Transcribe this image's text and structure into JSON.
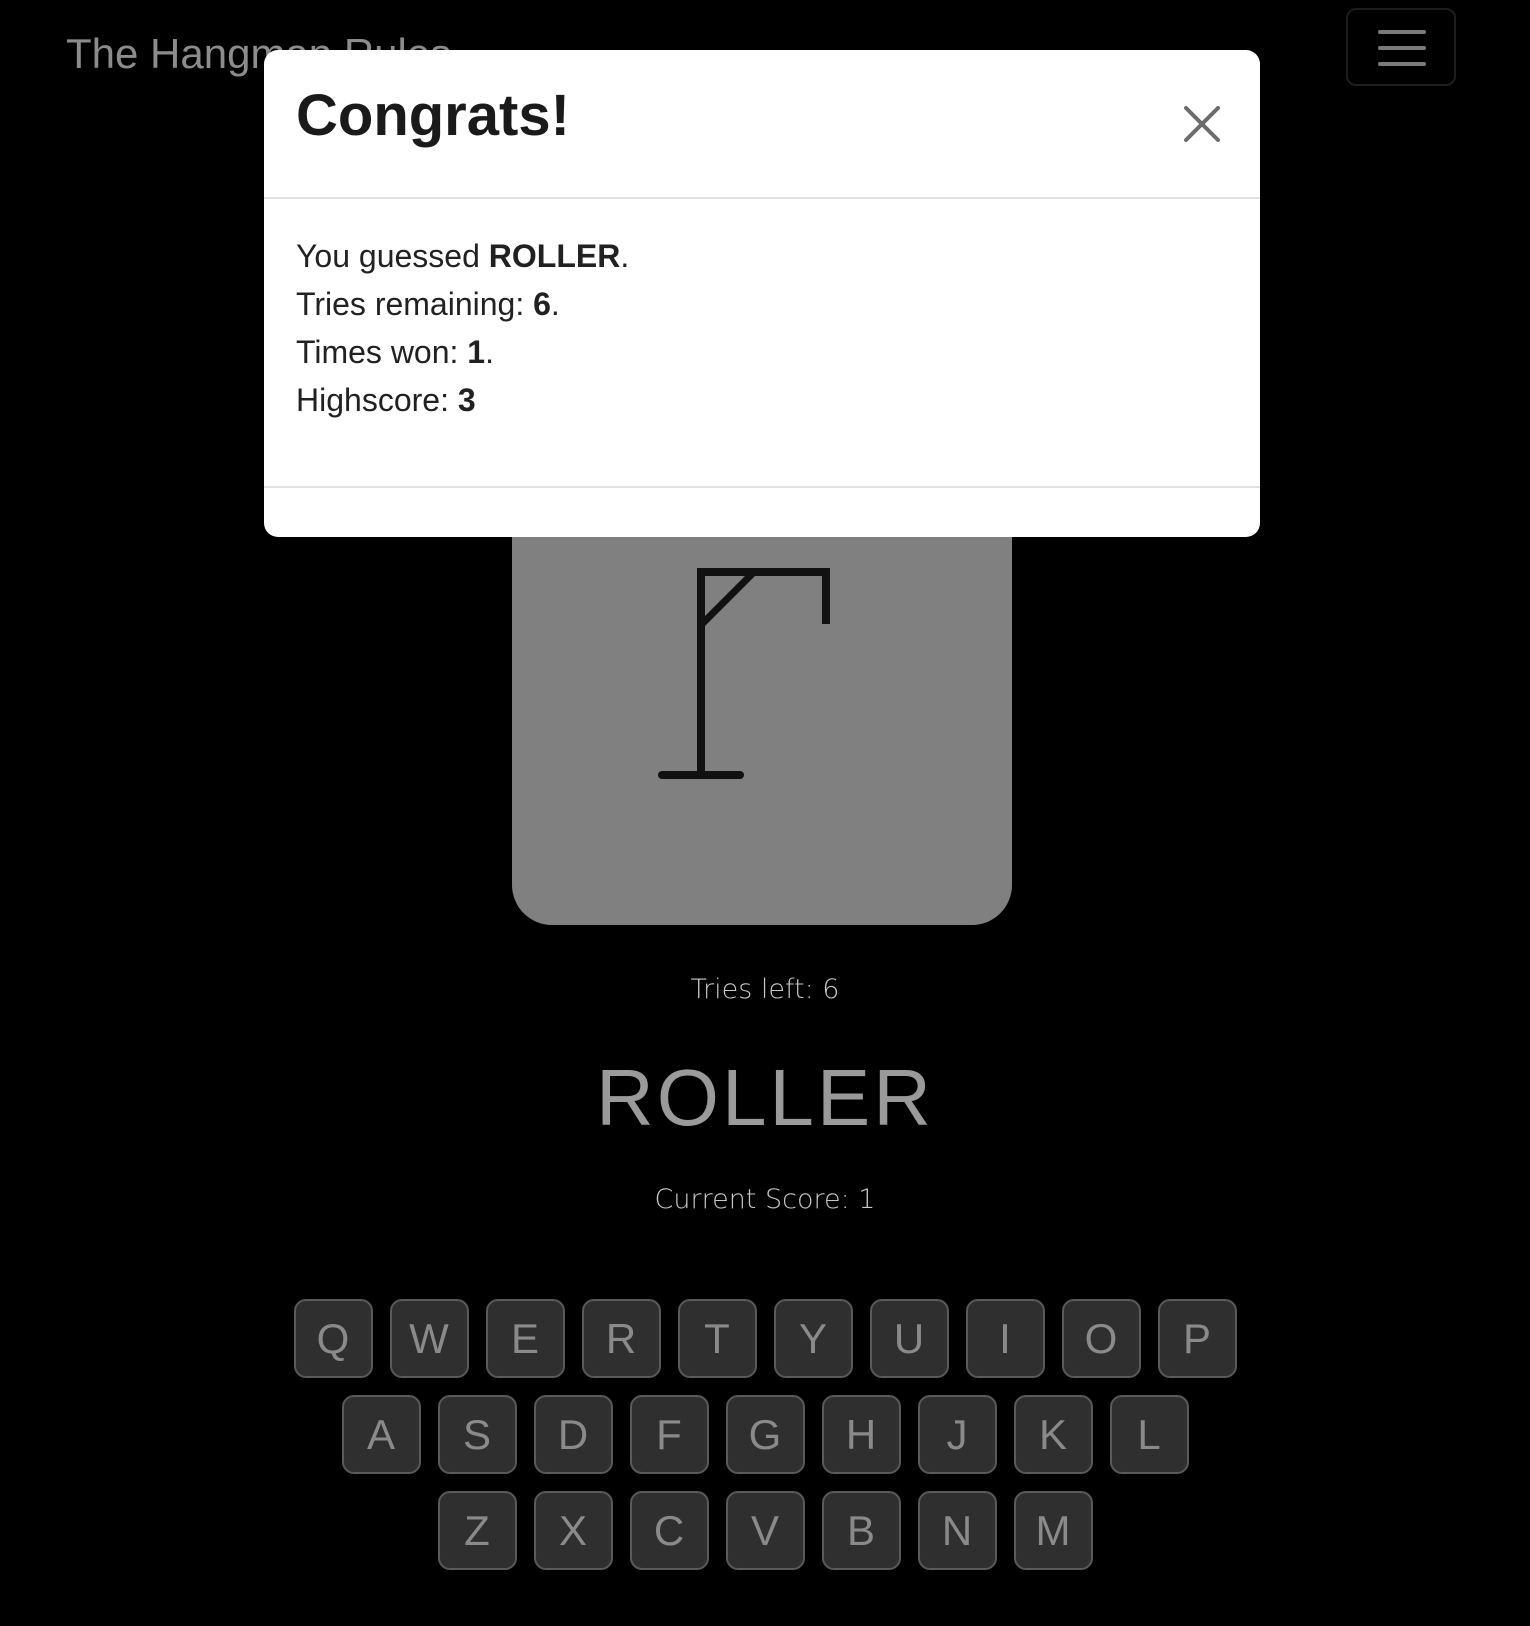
{
  "navbar": {
    "brand": "The Hangman Rules",
    "menu_icon": "hamburger-icon"
  },
  "modal": {
    "title": "Congrats!",
    "close_icon": "close-icon",
    "lines": [
      {
        "label": "You guessed ",
        "value": "ROLLER",
        "suffix": "."
      },
      {
        "label": "Tries remaining: ",
        "value": "6",
        "suffix": "."
      },
      {
        "label": "Times won: ",
        "value": "1",
        "suffix": "."
      },
      {
        "label": "Highscore: ",
        "value": "3",
        "suffix": ""
      }
    ]
  },
  "game": {
    "tries_left": "Tries left: 6",
    "word": "ROLLER",
    "current_score": "Current Score: 1",
    "card_color": "#808080"
  },
  "keyboard": {
    "rows": [
      [
        "Q",
        "W",
        "E",
        "R",
        "T",
        "Y",
        "U",
        "I",
        "O",
        "P"
      ],
      [
        "A",
        "S",
        "D",
        "F",
        "G",
        "H",
        "J",
        "K",
        "L"
      ],
      [
        "Z",
        "X",
        "C",
        "V",
        "B",
        "N",
        "M"
      ]
    ]
  }
}
